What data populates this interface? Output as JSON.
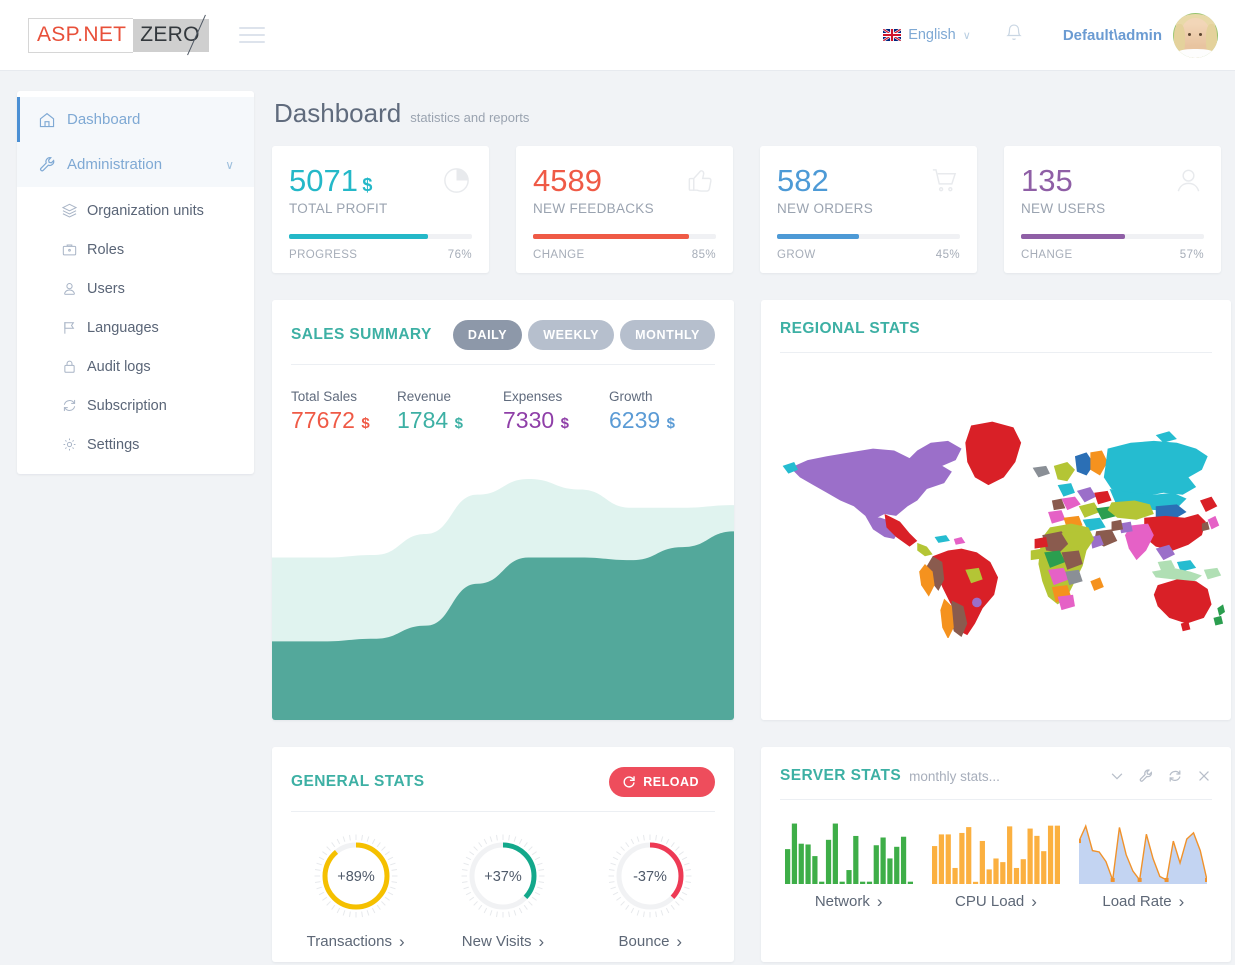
{
  "header": {
    "logo_primary": "ASP.NET",
    "logo_secondary": "ZERO",
    "menu_icon": "hamburger-icon",
    "language": "English",
    "language_caret": "∨",
    "notification_icon": "bell-icon",
    "user_name": "Default\\admin",
    "avatar_icon": "user-avatar"
  },
  "sidebar": {
    "items": [
      {
        "label": "Dashboard",
        "icon": "home-icon",
        "active": true
      },
      {
        "label": "Administration",
        "icon": "wrench-icon",
        "active": false,
        "caret": "∨"
      }
    ],
    "subitems": [
      {
        "label": "Organization units",
        "icon": "layers-icon"
      },
      {
        "label": "Roles",
        "icon": "briefcase-icon"
      },
      {
        "label": "Users",
        "icon": "users-icon"
      },
      {
        "label": "Languages",
        "icon": "flag-icon"
      },
      {
        "label": "Audit logs",
        "icon": "lock-icon"
      },
      {
        "label": "Subscription",
        "icon": "refresh-icon"
      },
      {
        "label": "Settings",
        "icon": "gear-icon"
      }
    ]
  },
  "page": {
    "title": "Dashboard",
    "subtitle": "statistics and reports"
  },
  "tiles": [
    {
      "value": "5071",
      "currency": "$",
      "label": "TOTAL PROFIT",
      "bar_label": "PROGRESS",
      "percent": "76%",
      "percent_num": 76,
      "color": "#24b8c8",
      "icon": "pie-chart-icon"
    },
    {
      "value": "4589",
      "currency": "",
      "label": "NEW FEEDBACKS",
      "bar_label": "CHANGE",
      "percent": "85%",
      "percent_num": 85,
      "color": "#ef5a46",
      "icon": "thumbs-up-icon"
    },
    {
      "value": "582",
      "currency": "",
      "label": "NEW ORDERS",
      "bar_label": "GROW",
      "percent": "45%",
      "percent_num": 45,
      "color": "#4d9ad6",
      "icon": "cart-icon"
    },
    {
      "value": "135",
      "currency": "",
      "label": "NEW USERS",
      "bar_label": "CHANGE",
      "percent": "57%",
      "percent_num": 57,
      "color": "#8f5fa6",
      "icon": "user-icon"
    }
  ],
  "sales_summary": {
    "title": "SALES SUMMARY",
    "tabs": [
      {
        "label": "DAILY",
        "active": true
      },
      {
        "label": "WEEKLY",
        "active": false
      },
      {
        "label": "MONTHLY",
        "active": false
      }
    ],
    "figures": [
      {
        "label": "Total Sales",
        "value": "77672",
        "currency": "$",
        "color": "#ef5a46"
      },
      {
        "label": "Revenue",
        "value": "1784",
        "currency": "$",
        "color": "#3db0a4"
      },
      {
        "label": "Expenses",
        "value": "7330",
        "currency": "$",
        "color": "#8f3fa8"
      },
      {
        "label": "Growth",
        "value": "6239",
        "currency": "$",
        "color": "#5b9bd5"
      }
    ]
  },
  "regional_stats": {
    "title": "REGIONAL STATS",
    "map_icon": "world-map"
  },
  "general_stats": {
    "title": "GENERAL STATS",
    "reload_label": "RELOAD",
    "reload_icon": "refresh-icon",
    "gauges": [
      {
        "label": "Transactions",
        "value": "+89%",
        "percent": 89,
        "color": "#f5c000"
      },
      {
        "label": "New Visits",
        "value": "+37%",
        "percent": 37,
        "color": "#13a88b"
      },
      {
        "label": "Bounce",
        "value": "-37%",
        "percent": 37,
        "color": "#ee3a55"
      }
    ]
  },
  "server_stats": {
    "title": "SERVER STATS",
    "subtitle": "monthly stats...",
    "tools": [
      {
        "icon": "chevron-down-icon"
      },
      {
        "icon": "wrench-icon"
      },
      {
        "icon": "refresh-icon"
      },
      {
        "icon": "close-icon"
      }
    ],
    "sparklines": [
      {
        "label": "Network",
        "type": "bar",
        "color": "#3eae48"
      },
      {
        "label": "CPU Load",
        "type": "bar",
        "color": "#fbb040"
      },
      {
        "label": "Load Rate",
        "type": "area",
        "color": "#f0922b",
        "fill": "#c3d4f2"
      }
    ]
  },
  "chart_data": [
    {
      "type": "area",
      "title": "Sales Summary",
      "name": "sales-summary-area",
      "x": [
        0,
        1,
        2,
        3,
        4,
        5,
        6,
        7,
        8,
        9
      ],
      "series": [
        {
          "name": "lower",
          "color": "#53a89b",
          "values": [
            30,
            30,
            31,
            36,
            52,
            62,
            62,
            61,
            66,
            72
          ]
        },
        {
          "name": "upper",
          "color": "#e0f3ef",
          "values": [
            62,
            62,
            63,
            71,
            86,
            92,
            88,
            81,
            81,
            82
          ]
        }
      ],
      "grid": false,
      "legend": "none"
    },
    {
      "type": "bar",
      "name": "network-sparkline",
      "title": "Network",
      "color": "#3eae48",
      "values": [
        45,
        78,
        52,
        51,
        36,
        3,
        57,
        78,
        3,
        18,
        62,
        3,
        3,
        50,
        60,
        33,
        48,
        61,
        3
      ],
      "ylim": [
        0,
        80
      ]
    },
    {
      "type": "bar",
      "name": "cpu-load-sparkline",
      "title": "CPU Load",
      "color": "#fbb040",
      "values": [
        52,
        68,
        68,
        22,
        70,
        78,
        3,
        59,
        20,
        35,
        30,
        79,
        22,
        34,
        76,
        66,
        45,
        80,
        80
      ],
      "ylim": [
        0,
        85
      ]
    },
    {
      "type": "area",
      "name": "load-rate-sparkline",
      "title": "Load Rate",
      "color": "#f0922b",
      "fill": "#c3d4f2",
      "values": [
        60,
        82,
        46,
        44,
        30,
        3,
        80,
        40,
        16,
        3,
        70,
        34,
        8,
        3,
        60,
        28,
        63,
        72,
        46,
        3
      ],
      "ylim": [
        0,
        85
      ]
    }
  ],
  "world_map": {
    "regions": [
      {
        "name": "North America",
        "color": "#9b6fc9"
      },
      {
        "name": "Greenland",
        "color": "#d92027"
      },
      {
        "name": "Russia",
        "color": "#25bcd0"
      },
      {
        "name": "China",
        "color": "#d92027"
      },
      {
        "name": "Australia",
        "color": "#d92027"
      },
      {
        "name": "Brazil",
        "color": "#d92027"
      },
      {
        "name": "Argentina",
        "color": "#8a5b4e"
      },
      {
        "name": "India",
        "color": "#e561c6"
      },
      {
        "name": "Kazakhstan",
        "color": "#b4c535"
      },
      {
        "name": "Mongolia",
        "color": "#2b6fb5"
      },
      {
        "name": "Chile",
        "color": "#f5921e"
      },
      {
        "name": "Africa",
        "color": "#8a5b4e"
      }
    ]
  }
}
